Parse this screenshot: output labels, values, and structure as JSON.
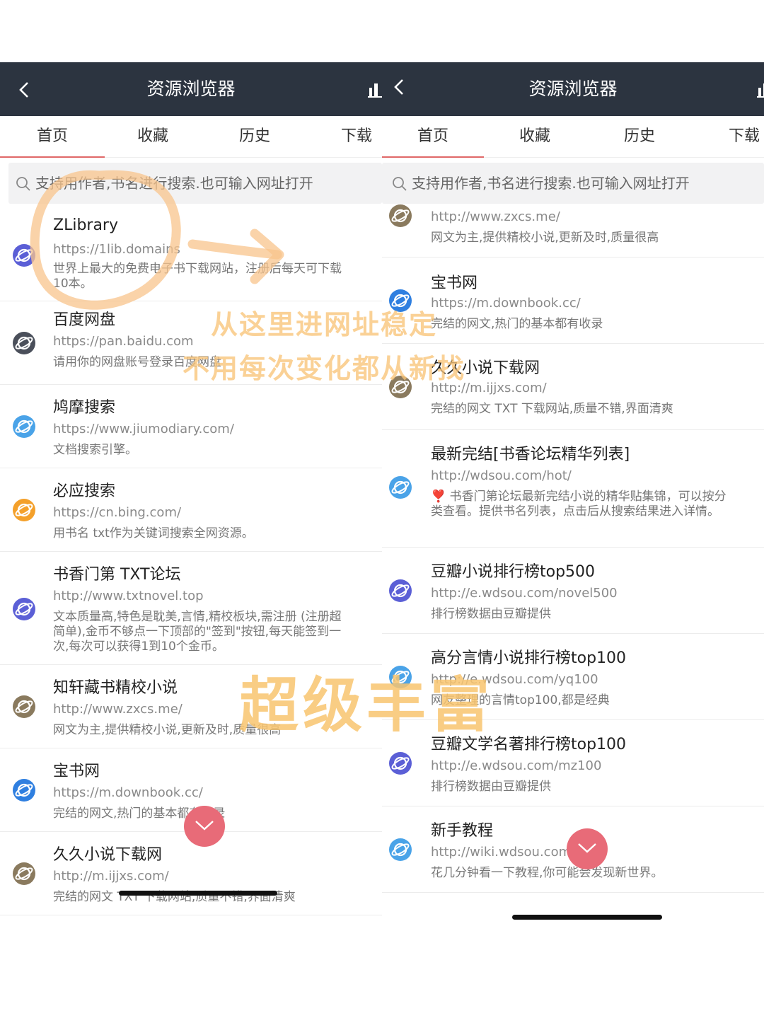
{
  "left": {
    "title": "资源浏览器",
    "tabs": [
      "首页",
      "收藏",
      "历史",
      "下载"
    ],
    "search_placeholder": "支持用作者,书名进行搜索.也可输入网址打开",
    "items": [
      {
        "title": "ZLibrary",
        "url": "https://1lib.domains",
        "desc": "世界上最大的免费电子书下载网站，注册后每天可下载10本。",
        "icon": "planet-icon",
        "color": "#5b5fd6"
      },
      {
        "title": "百度网盘",
        "url": "https://pan.baidu.com",
        "desc": "请用你的网盘账号登录百度网盘",
        "icon": "planet-icon",
        "color": "#4a4f5a"
      },
      {
        "title": "鸠摩搜索",
        "url": "https://www.jiumodiary.com/",
        "desc": "文档搜索引擎。",
        "icon": "planet-icon",
        "color": "#4aa3e8"
      },
      {
        "title": "必应搜索",
        "url": "https://cn.bing.com/",
        "desc": "用书名 txt作为关键词搜索全网资源。",
        "icon": "planet-icon",
        "color": "#f4a02a"
      },
      {
        "title": "书香门第 TXT论坛",
        "url": "http://www.txtnovel.top",
        "desc": "文本质量高,特色是耽美,言情,精校板块,需注册 (注册超简单),金币不够点一下顶部的\"签到\"按钮,每天能签到一次,每次可以获得1到10个金币。",
        "icon": "planet-icon",
        "color": "#5b5fd6"
      },
      {
        "title": "知轩藏书精校小说",
        "url": "http://www.zxcs.me/",
        "desc": "网文为主,提供精校小说,更新及时,质量很高",
        "icon": "planet-icon",
        "color": "#8a7a5e"
      },
      {
        "title": "宝书网",
        "url": "https://m.downbook.cc/",
        "desc": "完结的网文,热门的基本都有收录",
        "icon": "planet-icon",
        "color": "#2f7fe0"
      },
      {
        "title": "久久小说下载网",
        "url": "http://m.ijjxs.com/",
        "desc": "完结的网文 TXT 下载网站,质量不错,界面清爽",
        "icon": "planet-icon",
        "color": "#8a7a5e"
      }
    ]
  },
  "right": {
    "title": "资源浏览器",
    "tabs": [
      "首页",
      "收藏",
      "历史",
      "下载"
    ],
    "search_placeholder": "支持用作者,书名进行搜索.也可输入网址打开",
    "items": [
      {
        "title": "",
        "url": "http://www.zxcs.me/",
        "desc": "网文为主,提供精校小说,更新及时,质量很高",
        "icon": "planet-icon",
        "color": "#8a7a5e"
      },
      {
        "title": "宝书网",
        "url": "https://m.downbook.cc/",
        "desc": "完结的网文,热门的基本都有收录",
        "icon": "planet-icon",
        "color": "#2f7fe0"
      },
      {
        "title": "久久小说下载网",
        "url": "http://m.ijjxs.com/",
        "desc": "完结的网文 TXT 下载网站,质量不错,界面清爽",
        "icon": "planet-icon",
        "color": "#8a7a5e"
      },
      {
        "title": "最新完结[书香论坛精华列表]",
        "url": "http://wdsou.com/hot/",
        "desc": "❣️ 书香门第论坛最新完结小说的精华贴集锦，可以按分类查看。提供书名列表，点击后从搜索结果进入详情。",
        "icon": "planet-icon",
        "color": "#4aa3e8"
      },
      {
        "title": "豆瓣小说排行榜top500",
        "url": "http://e.wdsou.com/novel500",
        "desc": "排行榜数据由豆瓣提供",
        "icon": "planet-icon",
        "color": "#5b5fd6"
      },
      {
        "title": "高分言情小说排行榜top100",
        "url": "http://e.wdsou.com/yq100",
        "desc": "网友整理的言情top100,都是经典",
        "icon": "planet-icon",
        "color": "#4aa3e8"
      },
      {
        "title": "豆瓣文学名著排行榜top100",
        "url": "http://e.wdsou.com/mz100",
        "desc": "排行榜数据由豆瓣提供",
        "icon": "planet-icon",
        "color": "#5b5fd6"
      },
      {
        "title": "新手教程",
        "url": "http://wiki.wdsou.com",
        "desc": "花几分钟看一下教程,你可能会发现新世界。",
        "icon": "planet-icon",
        "color": "#4aa3e8"
      }
    ]
  },
  "overlay": {
    "line1": "从这里进网址稳定",
    "line2": "不用每次变化都从新找",
    "line3": "超级丰富"
  },
  "colors": {
    "navbar": "#2c3440",
    "accent": "#e06868",
    "fab": "#e86b78",
    "overlay": "#f8c478"
  }
}
